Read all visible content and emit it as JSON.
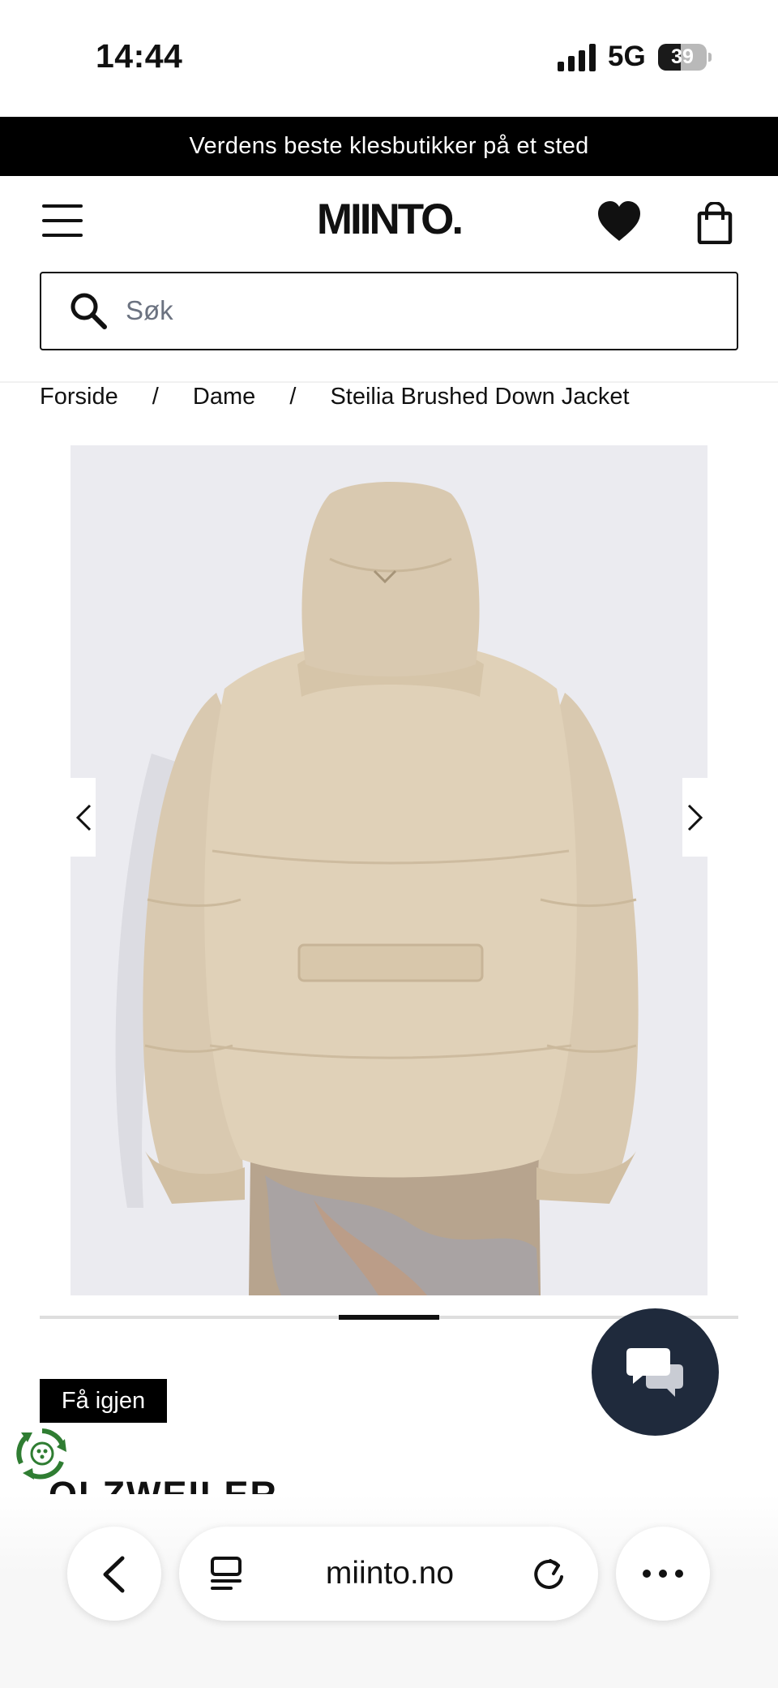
{
  "status_bar": {
    "time": "14:44",
    "network": "5G",
    "battery_level": "39"
  },
  "promo": {
    "text": "Verdens beste klesbutikker på et sted"
  },
  "header": {
    "logo": "MIINTO.",
    "menu_icon": "hamburger-menu-icon",
    "wishlist_icon": "heart-icon",
    "bag_icon": "shopping-bag-icon"
  },
  "search": {
    "placeholder": "Søk",
    "icon": "search-icon"
  },
  "breadcrumb": {
    "items": [
      "Forside",
      "Dame",
      "Steilia Brushed Down Jacket"
    ],
    "separator": "/"
  },
  "gallery": {
    "image": "product-photo-beige-down-jacket-back-view",
    "current_index": 3,
    "total_images": 7,
    "prev_icon": "chevron-left-icon",
    "next_icon": "chevron-right-icon"
  },
  "product": {
    "badge": "Få igjen",
    "brand_partial": "OLZWEILER"
  },
  "chat": {
    "icon": "chat-bubbles-icon",
    "bg_color": "#1f2a3c"
  },
  "browser": {
    "url": "miinto.no",
    "back_icon": "chevron-left-icon",
    "tabs_icon": "tabs-icon",
    "reload_icon": "reload-icon",
    "more_icon": "more-dots-icon"
  },
  "colors": {
    "promo_bg": "#000000",
    "text": "#111111",
    "eco_green": "#2f7d32"
  }
}
